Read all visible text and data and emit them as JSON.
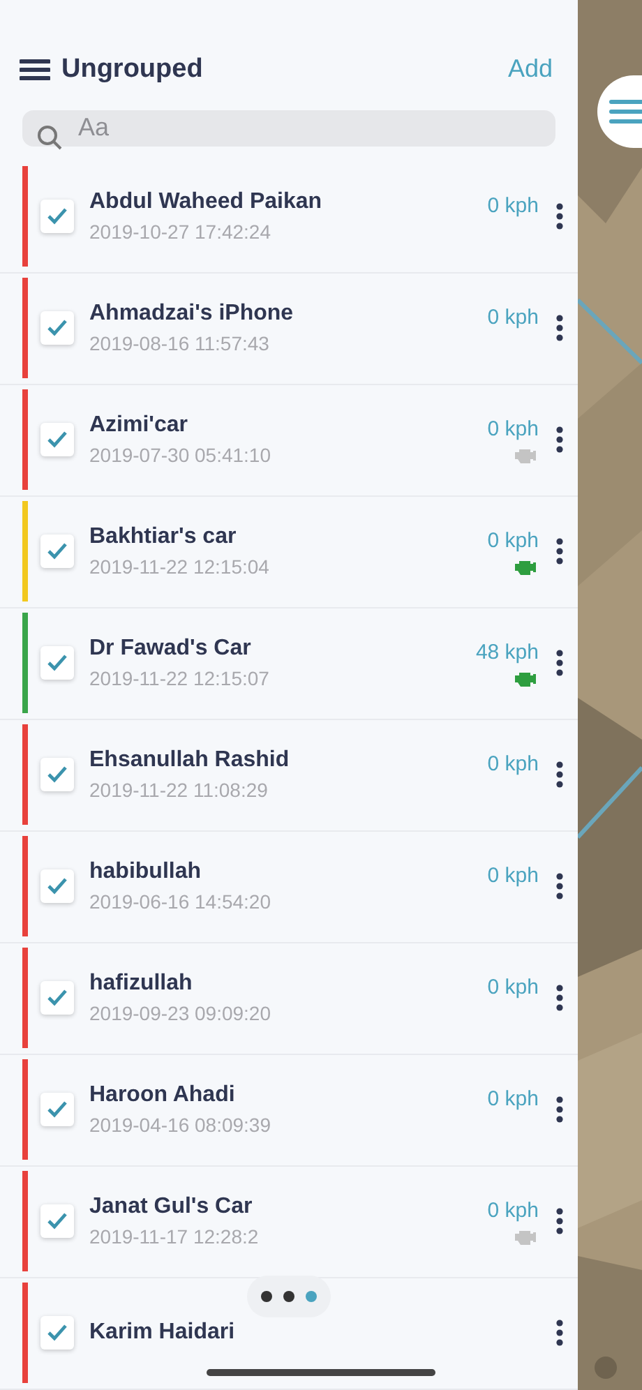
{
  "header": {
    "title": "Ungrouped",
    "action": "Add"
  },
  "search": {
    "placeholder": "Aa"
  },
  "devices": [
    {
      "name": "Abdul Waheed Paikan",
      "time": "2019-10-27 17:42:24",
      "speed": "0 kph",
      "color": "#e8413c",
      "checked": true
    },
    {
      "name": "Ahmadzai's iPhone",
      "time": "2019-08-16 11:57:43",
      "speed": "0 kph",
      "color": "#e8413c",
      "checked": true
    },
    {
      "name": "Azimi'car",
      "time": "2019-07-30 05:41:10",
      "speed": "0 kph",
      "color": "#e8413c",
      "checked": true,
      "engine": false
    },
    {
      "name": "Bakhtiar's car",
      "time": "2019-11-22 12:15:04",
      "speed": "0 kph",
      "color": "#f2c81e",
      "checked": true,
      "engine": true
    },
    {
      "name": "Dr Fawad's Car",
      "time": "2019-11-22 12:15:07",
      "speed": "48 kph",
      "color": "#3aa54a",
      "checked": true,
      "engine": true
    },
    {
      "name": "Ehsanullah Rashid",
      "time": "2019-11-22 11:08:29",
      "speed": "0 kph",
      "color": "#e8413c",
      "checked": true
    },
    {
      "name": "habibullah",
      "time": "2019-06-16 14:54:20",
      "speed": "0 kph",
      "color": "#e8413c",
      "checked": true
    },
    {
      "name": "hafizullah",
      "time": "2019-09-23 09:09:20",
      "speed": "0 kph",
      "color": "#e8413c",
      "checked": true
    },
    {
      "name": "Haroon Ahadi",
      "time": "2019-04-16 08:09:39",
      "speed": "0 kph",
      "color": "#e8413c",
      "checked": true
    },
    {
      "name": "Janat Gul's Car",
      "time": "2019-11-17 12:28:2",
      "speed": "0 kph",
      "color": "#e8413c",
      "checked": true,
      "engine": false
    },
    {
      "name": "Karim Haidari",
      "color": "#e8413c",
      "checked": true
    }
  ],
  "pager": [
    {
      "selected": false
    },
    {
      "selected": false
    },
    {
      "selected": true
    }
  ]
}
